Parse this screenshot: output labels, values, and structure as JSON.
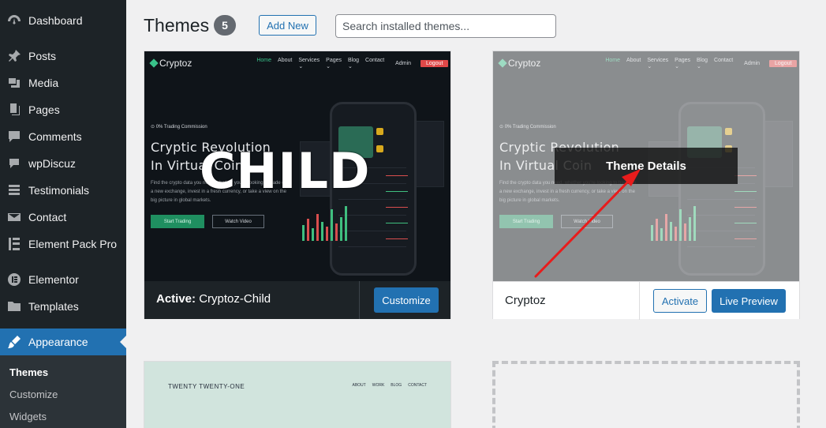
{
  "sidebar": {
    "items": [
      {
        "label": "Dashboard",
        "icon": "dashboard-icon"
      },
      {
        "label": "Posts",
        "icon": "pin-icon"
      },
      {
        "label": "Media",
        "icon": "media-icon"
      },
      {
        "label": "Pages",
        "icon": "pages-icon"
      },
      {
        "label": "Comments",
        "icon": "comment-icon"
      },
      {
        "label": "wpDiscuz",
        "icon": "chat-icon"
      },
      {
        "label": "Testimonials",
        "icon": "list-icon"
      },
      {
        "label": "Contact",
        "icon": "mail-icon"
      },
      {
        "label": "Element Pack Pro",
        "icon": "element-pack-icon"
      },
      {
        "label": "Elementor",
        "icon": "elementor-icon"
      },
      {
        "label": "Templates",
        "icon": "folder-icon"
      },
      {
        "label": "Appearance",
        "icon": "brush-icon"
      }
    ],
    "submenu": [
      "Themes",
      "Customize",
      "Widgets"
    ]
  },
  "header": {
    "title": "Themes",
    "count": "5",
    "add_new": "Add New",
    "search_placeholder": "Search installed themes..."
  },
  "themes": {
    "active": {
      "label": "Active:",
      "name": "Cryptoz-Child",
      "watermark": "CHILD",
      "customize": "Customize"
    },
    "cryptoz": {
      "name": "Cryptoz",
      "details": "Theme Details",
      "activate": "Activate",
      "preview": "Live Preview"
    },
    "screenshot": {
      "logo": "Cryptoz",
      "nav": [
        "Home",
        "About",
        "Services ⌄",
        "Pages ⌄",
        "Blog ⌄",
        "Contact"
      ],
      "admin": "Admin",
      "logout": "Logout",
      "badge": "⊙ 0% Trading Commission",
      "hero_line1": "Cryptic Revolution",
      "hero_line2": "In Virtual Coin",
      "desc": "Find the crypto data you need. whether you're looking to trade on a new exchange, invest in a fresh currency, or take a view on the big picture in global markets.",
      "btn_start": "Start Trading",
      "btn_video": "Watch Video"
    },
    "twenty_one": {
      "title": "TWENTY TWENTY-ONE",
      "nav": [
        "ABOUT",
        "WORK",
        "BLOG",
        "CONTACT"
      ]
    }
  },
  "colors": {
    "sidebar_bg": "#1d2327",
    "accent": "#2271b1",
    "annotation_arrow": "#e81c1c"
  }
}
